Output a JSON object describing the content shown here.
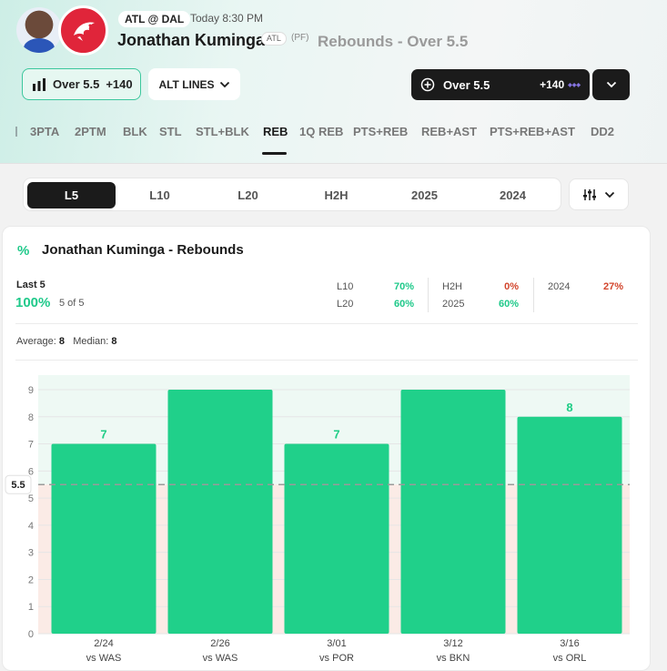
{
  "header": {
    "matchup": "ATL @ DAL",
    "time": "Today 8:30 PM",
    "player_name": "Jonathan Kuminga",
    "team": "ATL",
    "position": "(PF)",
    "prop": "Rebounds - Over 5.5"
  },
  "line_button": {
    "label": "Over 5.5",
    "odds": "+140"
  },
  "alt_lines": {
    "label": "ALT LINES"
  },
  "bet_button": {
    "label": "Over 5.5",
    "odds": "+140"
  },
  "stat_tabs": [
    "3PTA",
    "2PTM",
    "BLK",
    "STL",
    "STL+BLK",
    "REB",
    "1Q REB",
    "PTS+REB",
    "REB+AST",
    "PTS+REB+AST",
    "DD2"
  ],
  "active_tab": "REB",
  "range_tabs": [
    "L5",
    "L10",
    "L20",
    "H2H",
    "2025",
    "2024"
  ],
  "active_range": "L5",
  "card": {
    "title": "Jonathan Kuminga - Rebounds",
    "last_label": "Last 5",
    "last_pct": "100%",
    "last_of": "5 of 5",
    "stats": [
      {
        "label": "L10",
        "value": "70%",
        "tone": "green"
      },
      {
        "label": "L20",
        "value": "60%",
        "tone": "green"
      },
      {
        "label": "H2H",
        "value": "0%",
        "tone": "red"
      },
      {
        "label": "2025",
        "value": "60%",
        "tone": "green"
      },
      {
        "label": "2024",
        "value": "27%",
        "tone": "red"
      }
    ],
    "average_label": "Average:",
    "average": "8",
    "median_label": "Median:",
    "median": "8"
  },
  "colors": {
    "accent": "#1fcd86",
    "hit": "#20d08a",
    "miss": "#d2452c",
    "dark": "#1b1b1b"
  },
  "chart_data": {
    "type": "bar",
    "categories": [
      "2/24",
      "2/26",
      "3/01",
      "3/12",
      "3/16"
    ],
    "opponents": [
      "vs WAS",
      "vs WAS",
      "vs POR",
      "vs BKN",
      "vs ORL"
    ],
    "values": [
      7,
      9,
      7,
      9,
      8
    ],
    "labels": [
      "7",
      "",
      "7",
      "",
      "8"
    ],
    "line": 5.5,
    "line_label": "5.5",
    "ylim": [
      0,
      9
    ],
    "yticks": [
      "0",
      "1",
      "2",
      "3",
      "4",
      "5",
      "6",
      "7",
      "8",
      "9"
    ]
  }
}
